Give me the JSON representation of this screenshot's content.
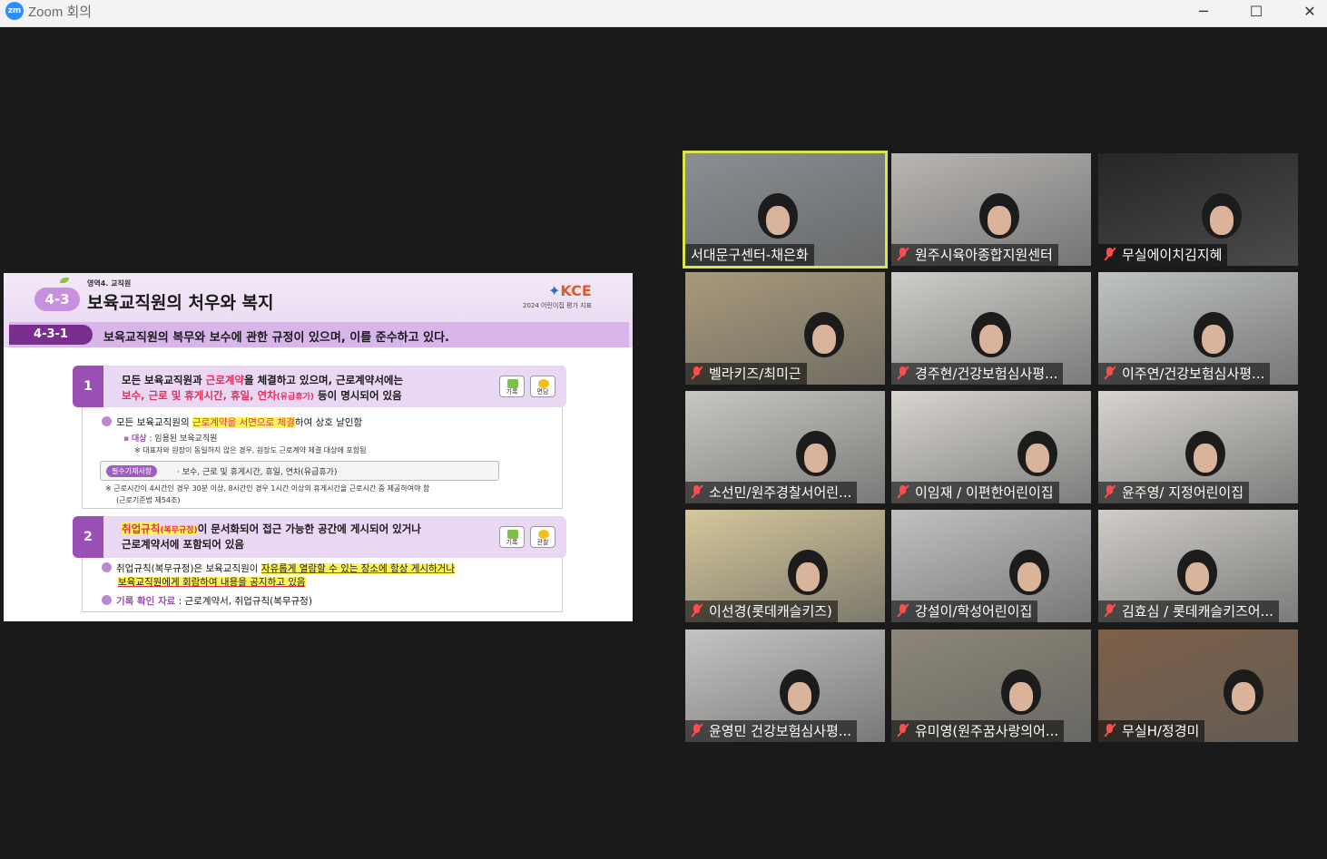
{
  "window": {
    "logo": "zm",
    "title": "Zoom 회의",
    "controls": {
      "minimize": "─",
      "maximize": "☐",
      "close": "✕"
    }
  },
  "slide": {
    "area_label": "영역4. 교직원",
    "badge": "4-3",
    "title": "보육교직원의 처우와 복지",
    "logo": "KCE",
    "logo_sub": "2024 어린이집 평가 지표",
    "section_num": "4-3-1",
    "section_text": "보육교직원의 복무와 보수에 관한 규정이 있으며, 이를 준수하고 있다.",
    "item1": {
      "num": "1",
      "line1_a": "모든 보육교직원과 ",
      "line1_hl": "근로계약",
      "line1_b": "을 체결하고 있으며, 근로계약서에는",
      "line2_hl": "보수, 근로 및 휴게시간, 휴일, 연차",
      "line2_paren": "(유급휴가)",
      "line2_b": " 등이 명시되어 있음",
      "chip_a": "기록",
      "chip_b": "면담"
    },
    "detail1": {
      "b1_a": "모든 보육교직원의 ",
      "b1_hl": "근로계약을 서면으로 체결",
      "b1_b": "하여 상호 날인함",
      "sub1_label": "대상",
      "sub1_text": " : 임용된 보육교직원",
      "sub2": "※  대표자와 원장이 동일하지 않은 경우, 원장도 근로계약 체결 대상에 포함됨",
      "mandatory_tag": "필수기재사항",
      "mandatory_text": "· 보수, 근로 및 휴게시간, 휴일, 연차(유급휴가)",
      "note1": "※  근로시간이 4시간인 경우 30분 이상, 8시간인 경우 1시간 이상의 휴게시간을 근로시간 중 제공하여야 함",
      "note2": "(근로기준법 제54조)"
    },
    "item2": {
      "num": "2",
      "line1_hl": "취업규칙",
      "line1_paren": "(복무규정)",
      "line1_b": "이 문서화되어 접근 가능한 공간에 게시되어 있거나",
      "line2": "근로계약서에 포함되어 있음",
      "chip_a": "기록",
      "chip_b": "관찰"
    },
    "detail2": {
      "b1_a": "취업규칙(복무규정)은 보육교직원이 ",
      "b1_hl": "자유롭게 열람할 수 있는 장소에 항상 게시하거나",
      "b2_hl": "보육교직원에게 회람하여 내용을 공지하고 있음",
      "records_label": "기록 확인 자료",
      "records_text": " : 근로계약서, 취업규칙(복무규정)"
    }
  },
  "participants": [
    {
      "name": "서대문구센터-채은화",
      "muted": false,
      "active": true,
      "bg": "#8a8f93"
    },
    {
      "name": "원주시육아종합지원센터",
      "muted": true,
      "active": false,
      "bg": "#b9b6b3"
    },
    {
      "name": "무실에이치김지혜",
      "muted": true,
      "active": false,
      "bg": "#262626"
    },
    {
      "name": "벨라키즈/최미근",
      "muted": true,
      "active": false,
      "bg": "#a89a7a"
    },
    {
      "name": "경주현/건강보험심사평...",
      "muted": true,
      "active": false,
      "bg": "#cfcdc9"
    },
    {
      "name": "이주연/건강보험심사평...",
      "muted": true,
      "active": false,
      "bg": "#bfc3c2"
    },
    {
      "name": "소선민/원주경찰서어린...",
      "muted": true,
      "active": false,
      "bg": "#c9c7c2"
    },
    {
      "name": "이임재 / 이편한어린이집",
      "muted": true,
      "active": false,
      "bg": "#d8d5d0"
    },
    {
      "name": "윤주영/ 지정어린이집",
      "muted": true,
      "active": false,
      "bg": "#d7d4cf"
    },
    {
      "name": "이선경(롯데캐슬키즈)",
      "muted": true,
      "active": false,
      "bg": "#d4c79a"
    },
    {
      "name": "강설이/학성어린이집",
      "muted": true,
      "active": false,
      "bg": "#bfc2c0"
    },
    {
      "name": "김효심 / 롯데캐슬키즈어...",
      "muted": true,
      "active": false,
      "bg": "#d0cdc8"
    },
    {
      "name": "윤영민 건강보험심사평...",
      "muted": true,
      "active": false,
      "bg": "#c6c4c2"
    },
    {
      "name": "유미영(원주꿈사랑의어...",
      "muted": true,
      "active": false,
      "bg": "#8c8778"
    },
    {
      "name": "무실H/정경미",
      "muted": true,
      "active": false,
      "bg": "#7d6048"
    }
  ]
}
